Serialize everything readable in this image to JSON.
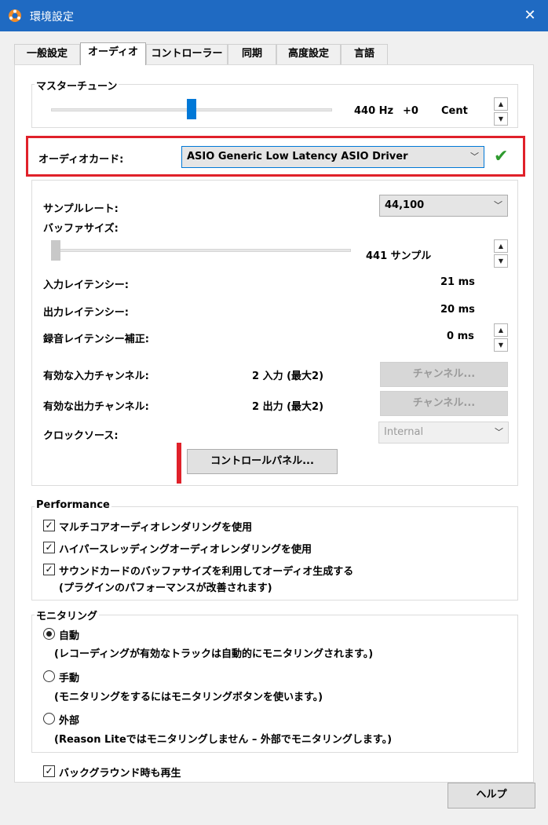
{
  "window": {
    "title": "環境設定"
  },
  "tabs": [
    "一般設定",
    "オーディオ",
    "コントローラー",
    "同期",
    "高度設定",
    "言語"
  ],
  "master_tune": {
    "group_label": "マスターチューン",
    "hz": "440 Hz",
    "offset": "+0",
    "unit": "Cent",
    "slider_level": 0.5
  },
  "audio_card": {
    "label": "オーディオカード:",
    "value": "ASIO Generic Low Latency ASIO Driver"
  },
  "sample_rate": {
    "label": "サンプルレート:",
    "value": "44,100"
  },
  "buffer": {
    "label": "バッファサイズ:",
    "value": "441 サンプル",
    "slider_level": 0.0
  },
  "input_latency": {
    "label": "入力レイテンシー:",
    "value": "21 ms"
  },
  "output_latency": {
    "label": "出力レイテンシー:",
    "value": "20 ms"
  },
  "rec_latency": {
    "label": "録音レイテンシー補正:",
    "value": "0 ms"
  },
  "input_channels": {
    "label": "有効な入力チャンネル:",
    "value": "2 入力 (最大2)",
    "button": "チャンネル..."
  },
  "output_channels": {
    "label": "有効な出力チャンネル:",
    "value": "2 出力 (最大2)",
    "button": "チャンネル..."
  },
  "clock_source": {
    "label": "クロックソース:",
    "value": "Internal"
  },
  "control_panel_button": "コントロールパネル...",
  "performance": {
    "group_label": "Performance",
    "options": [
      {
        "label": "マルチコアオーディオレンダリングを使用",
        "checked": true
      },
      {
        "label": "ハイパースレッディングオーディオレンダリングを使用",
        "checked": true
      },
      {
        "label": "サウンドカードのバッファサイズを利用してオーディオ生成する",
        "checked": true
      }
    ],
    "note": "(プラグインのパフォーマンスが改善されます)"
  },
  "monitoring": {
    "group_label": "モニタリング",
    "options": [
      {
        "label": "自動",
        "desc": "(レコーディングが有効なトラックは自動的にモニタリングされます。)",
        "selected": true
      },
      {
        "label": "手動",
        "desc": "(モニタリングをするにはモニタリングボタンを使います。)",
        "selected": false
      },
      {
        "label": "外部",
        "desc": "(Reason Liteではモニタリングしません – 外部でモニタリングします。)",
        "selected": false
      }
    ]
  },
  "background_play": {
    "label": "バックグラウンド時も再生",
    "checked": true
  },
  "help_button": "ヘルプ",
  "colors": {
    "titlebar": "#1f6ac2",
    "highlight": "#e0212a",
    "check_ok": "#2e9a2e",
    "thumb_active": "#0078d7"
  }
}
